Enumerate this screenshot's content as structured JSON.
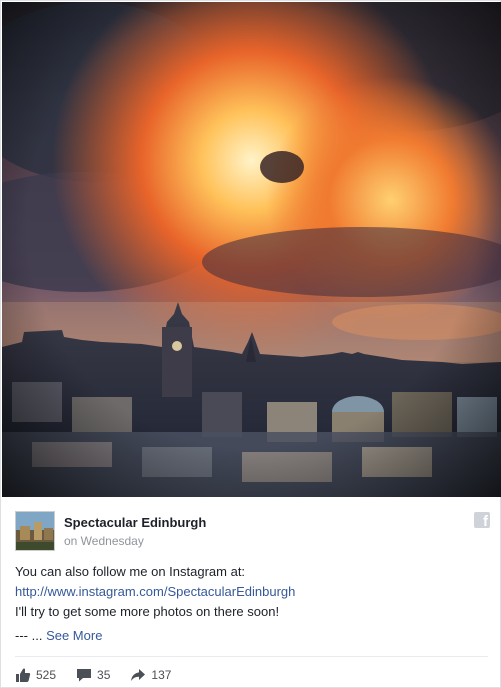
{
  "post": {
    "page_name": "Spectacular Edinburgh",
    "time": "on Wednesday",
    "text_line1": "You can also follow me on Instagram at:",
    "link": "http://www.instagram.com/SpectacularEdinburgh",
    "text_line3": "I'll try to get some more photos on there soon!",
    "ellipsis": "--- ...",
    "see_more": "See More"
  },
  "reactions": {
    "likes": "525",
    "comments": "35",
    "shares": "137"
  },
  "icons": {
    "brand": "facebook-icon",
    "like": "thumbs-up-icon",
    "comment": "comment-bubble-icon",
    "share": "share-arrow-icon"
  },
  "colors": {
    "link": "#365899",
    "muted": "#90949c",
    "icon": "#4b4f56"
  }
}
